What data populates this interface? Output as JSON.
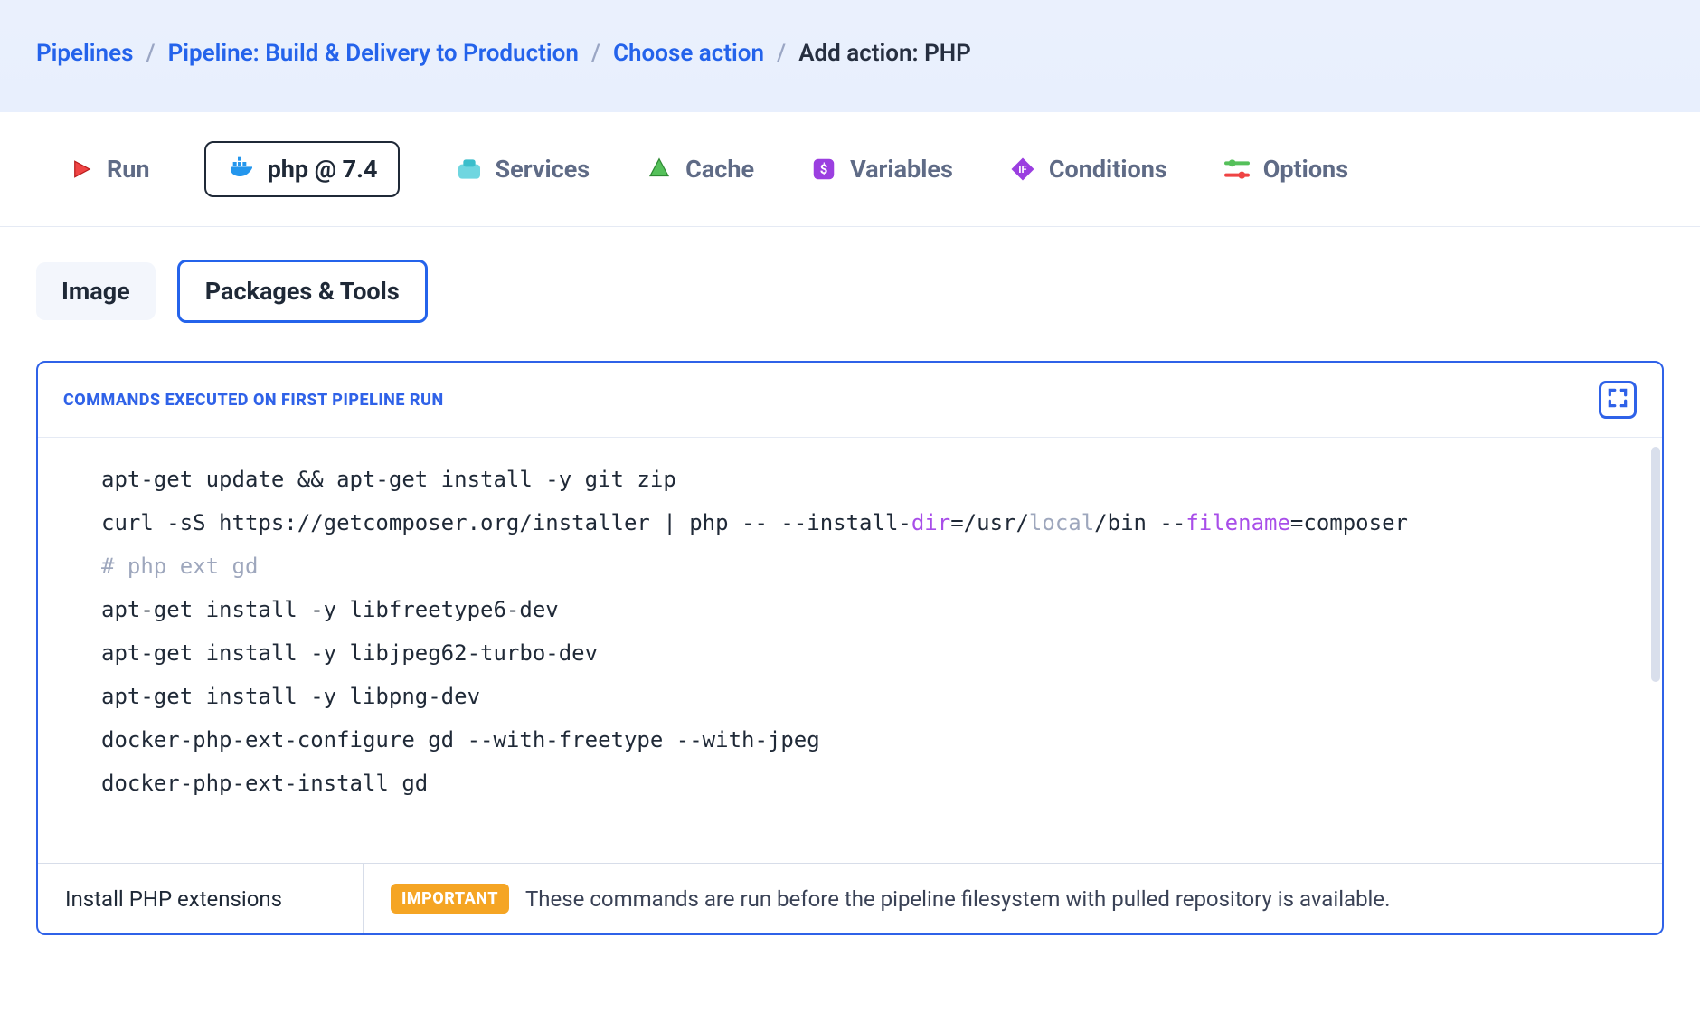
{
  "breadcrumb": {
    "items": [
      {
        "label": "Pipelines"
      },
      {
        "label": "Pipeline: Build & Delivery to Production"
      },
      {
        "label": "Choose action"
      }
    ],
    "current": "Add action: PHP"
  },
  "tabs": {
    "run": "Run",
    "env": "php @ 7.4",
    "services": "Services",
    "cache": "Cache",
    "variables": "Variables",
    "conditions": "Conditions",
    "options": "Options"
  },
  "subtabs": {
    "image": "Image",
    "packages": "Packages & Tools"
  },
  "editor": {
    "header": "COMMANDS EXECUTED ON FIRST PIPELINE RUN",
    "lines": {
      "l1a": "apt-get update && apt-get install -y git zip",
      "l2a": "curl -sS https://getcomposer.org/installer | php -- --install-",
      "l2b": "dir",
      "l2c": "=/usr/",
      "l2d": "local",
      "l2e": "/bin --",
      "l2f": "filename",
      "l2g": "=composer",
      "l3": "",
      "l4": "# php ext gd",
      "l5": "apt-get install -y libfreetype6-dev",
      "l6": "apt-get install -y libjpeg62-turbo-dev",
      "l7": "apt-get install -y libpng-dev",
      "l8": "docker-php-ext-configure gd --with-freetype --with-jpeg",
      "l9": "docker-php-ext-install gd"
    }
  },
  "footer": {
    "left": "Install PHP extensions",
    "badge": "IMPORTANT",
    "text": "These commands are run before the pipeline filesystem with pulled repository is available."
  }
}
